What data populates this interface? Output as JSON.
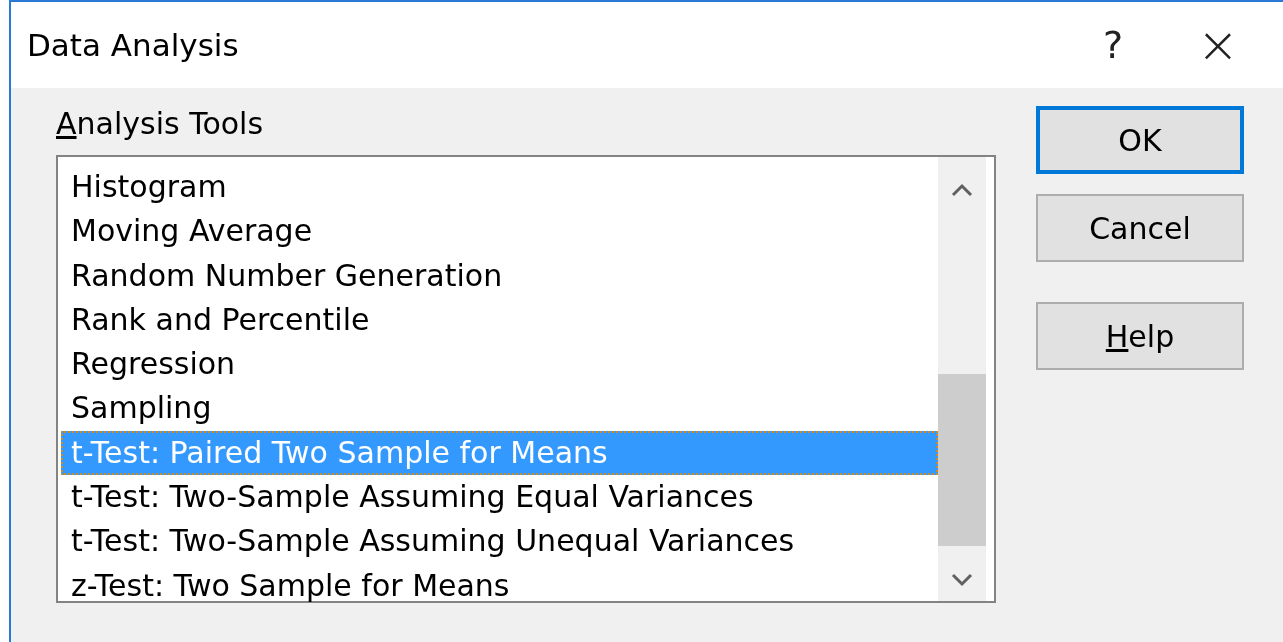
{
  "window": {
    "title": "Data Analysis",
    "help_glyph": "?",
    "close_glyph": "×"
  },
  "list": {
    "label": "Analysis Tools",
    "items": [
      {
        "label": "Histogram",
        "selected": false
      },
      {
        "label": "Moving Average",
        "selected": false
      },
      {
        "label": "Random Number Generation",
        "selected": false
      },
      {
        "label": "Rank and Percentile",
        "selected": false
      },
      {
        "label": "Regression",
        "selected": false
      },
      {
        "label": "Sampling",
        "selected": false
      },
      {
        "label": "t-Test: Paired Two Sample for Means",
        "selected": true
      },
      {
        "label": "t-Test: Two-Sample Assuming Equal Variances",
        "selected": false
      },
      {
        "label": "t-Test: Two-Sample Assuming Unequal Variances",
        "selected": false
      },
      {
        "label": "z-Test: Two Sample for Means",
        "selected": false
      }
    ]
  },
  "buttons": [
    {
      "label": "OK",
      "default": true
    },
    {
      "label": "Cancel",
      "default": false
    },
    {
      "label": "Help",
      "default": false
    }
  ]
}
